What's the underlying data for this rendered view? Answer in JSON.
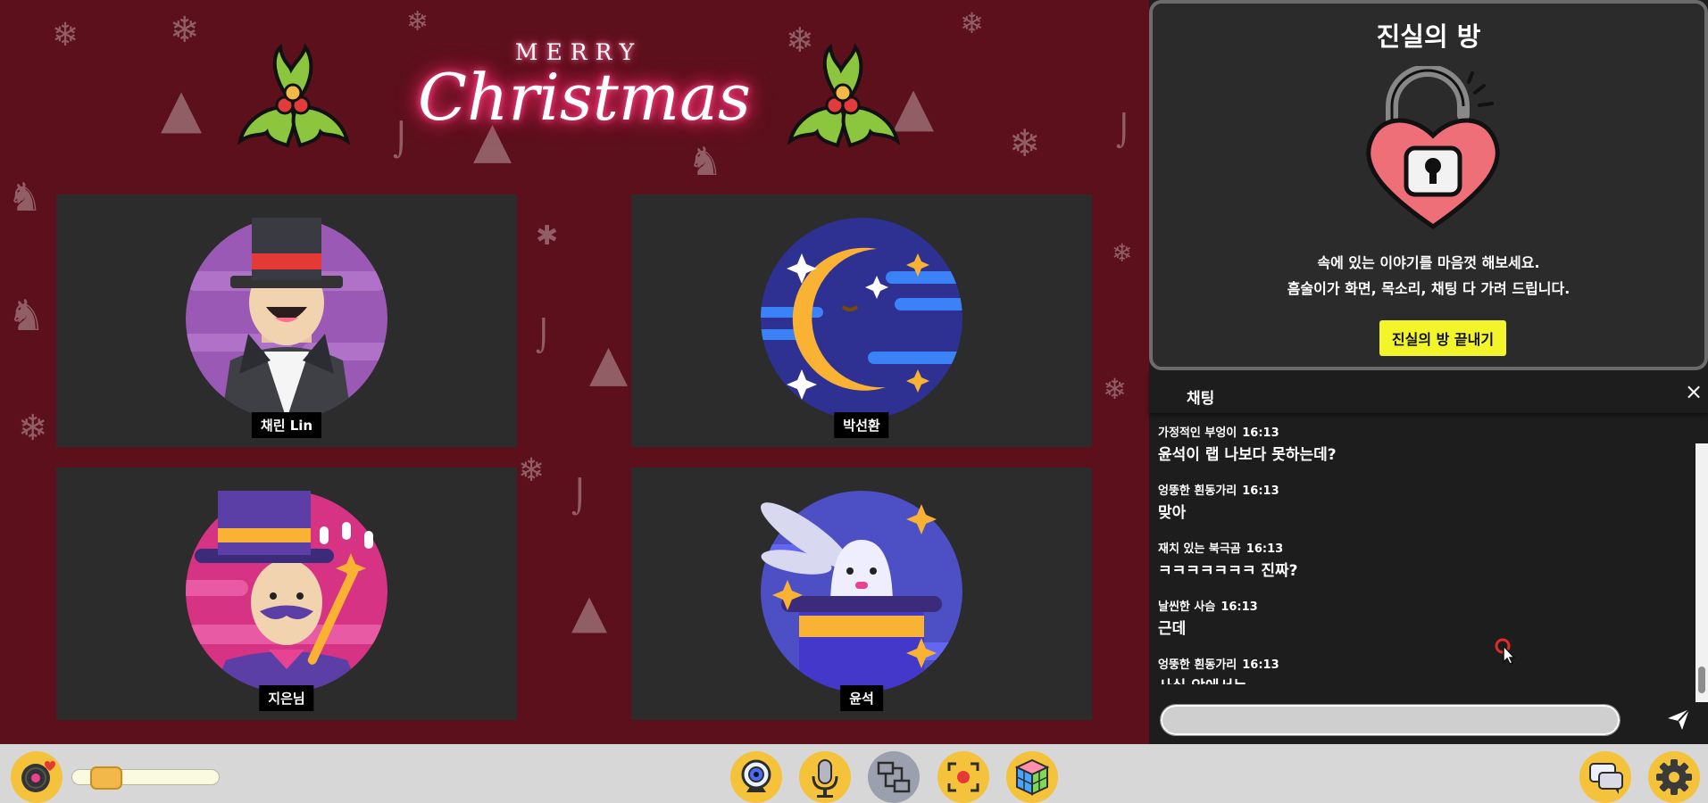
{
  "banner": {
    "line1": "MERRY",
    "line2": "Christmas"
  },
  "participants": [
    {
      "name": "채린 Lin",
      "avatar": "magician-tophat-icon"
    },
    {
      "name": "박선환",
      "avatar": "moon-night-icon"
    },
    {
      "name": "지은님",
      "avatar": "magician-wand-icon"
    },
    {
      "name": "윤석",
      "avatar": "rabbit-hat-icon"
    }
  ],
  "truth_room": {
    "title": "진실의 방",
    "desc_line1": "속에 있는 이야기를 마음껏 해보세요.",
    "desc_line2": "흠술이가 화면, 목소리, 채팅 다 가려 드립니다.",
    "end_button": "진실의 방 끝내기",
    "button_color": "#f3f52b"
  },
  "chat": {
    "title": "채팅",
    "close": "×",
    "messages": [
      {
        "sender": "가정적인 부엉이",
        "time": "16:13",
        "text": "윤석이 랩 나보다 못하는데?"
      },
      {
        "sender": "엉뚱한 흰동가리",
        "time": "16:13",
        "text": "맞아"
      },
      {
        "sender": "재치 있는 북극곰",
        "time": "16:13",
        "text": "ㅋㅋㅋㅋㅋㅋㅋ 진짜?"
      },
      {
        "sender": "날씬한 사슴",
        "time": "16:13",
        "text": "근데"
      },
      {
        "sender": "엉뚱한 흰동가리",
        "time": "16:13",
        "text": "사실 앞에서는"
      }
    ],
    "input_value": "",
    "send_icon": "send-icon"
  },
  "toolbar": {
    "music_icon": "music-disc-icon",
    "volume_level": 0.1,
    "buttons": [
      "webcam-icon",
      "microphone-icon",
      "screen-share-icon",
      "focus-mode-icon",
      "cube-game-icon"
    ],
    "chat_icon": "chat-bubble-icon",
    "settings_icon": "gear-icon"
  },
  "colors": {
    "stage_bg": "#5c101c",
    "toolbar_bg": "#d7d7d7",
    "button_yellow": "#f5c33b",
    "panel_bg": "#2b2b2b"
  }
}
